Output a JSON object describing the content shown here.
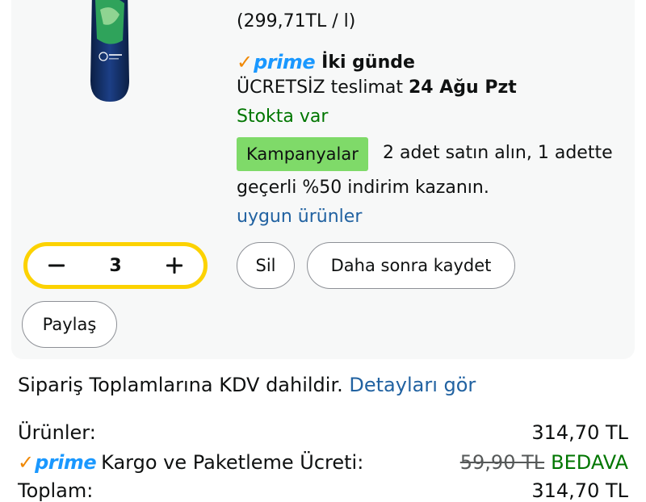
{
  "product": {
    "unit_price": "(299,71TL / l)",
    "prime_word": "prime",
    "prime_delivery": "İki günde",
    "delivery_prefix": "ÜCRETSİZ teslimat",
    "delivery_date": "24 Ağu Pzt",
    "stock_status": "Stokta var",
    "promo_badge": "Kampanyalar",
    "promo_text_line1": "2 adet satın alın, 1 adette",
    "promo_text_line2": "geçerli %50 indirim kazanın.",
    "promo_link": "uygun ürünler"
  },
  "quantity": {
    "value": "3"
  },
  "actions": {
    "delete_label": "Sil",
    "save_later_label": "Daha sonra kaydet",
    "share_label": "Paylaş"
  },
  "summary": {
    "vat_text": "Sipariş Toplamlarına KDV dahildir.",
    "vat_link": "Detayları gör",
    "items_label": "Ürünler:",
    "items_value": "314,70 TL",
    "prime_word": "prime",
    "shipping_label": "Kargo ve Paketleme Ücreti:",
    "shipping_old": "59,90 TL",
    "shipping_free": "BEDAVA",
    "total_label": "Toplam:",
    "total_value": "314,70 TL"
  },
  "colors": {
    "accent_blue": "#2162a1",
    "prime_blue": "#1a98ff",
    "prime_orange": "#f08804",
    "in_stock_green": "#007600",
    "promo_green": "#7fda69",
    "qty_border_yellow": "#fcd200"
  },
  "icons": [
    "shampoo-bottle-image",
    "prime-check-icon",
    "minus-icon",
    "plus-icon"
  ]
}
